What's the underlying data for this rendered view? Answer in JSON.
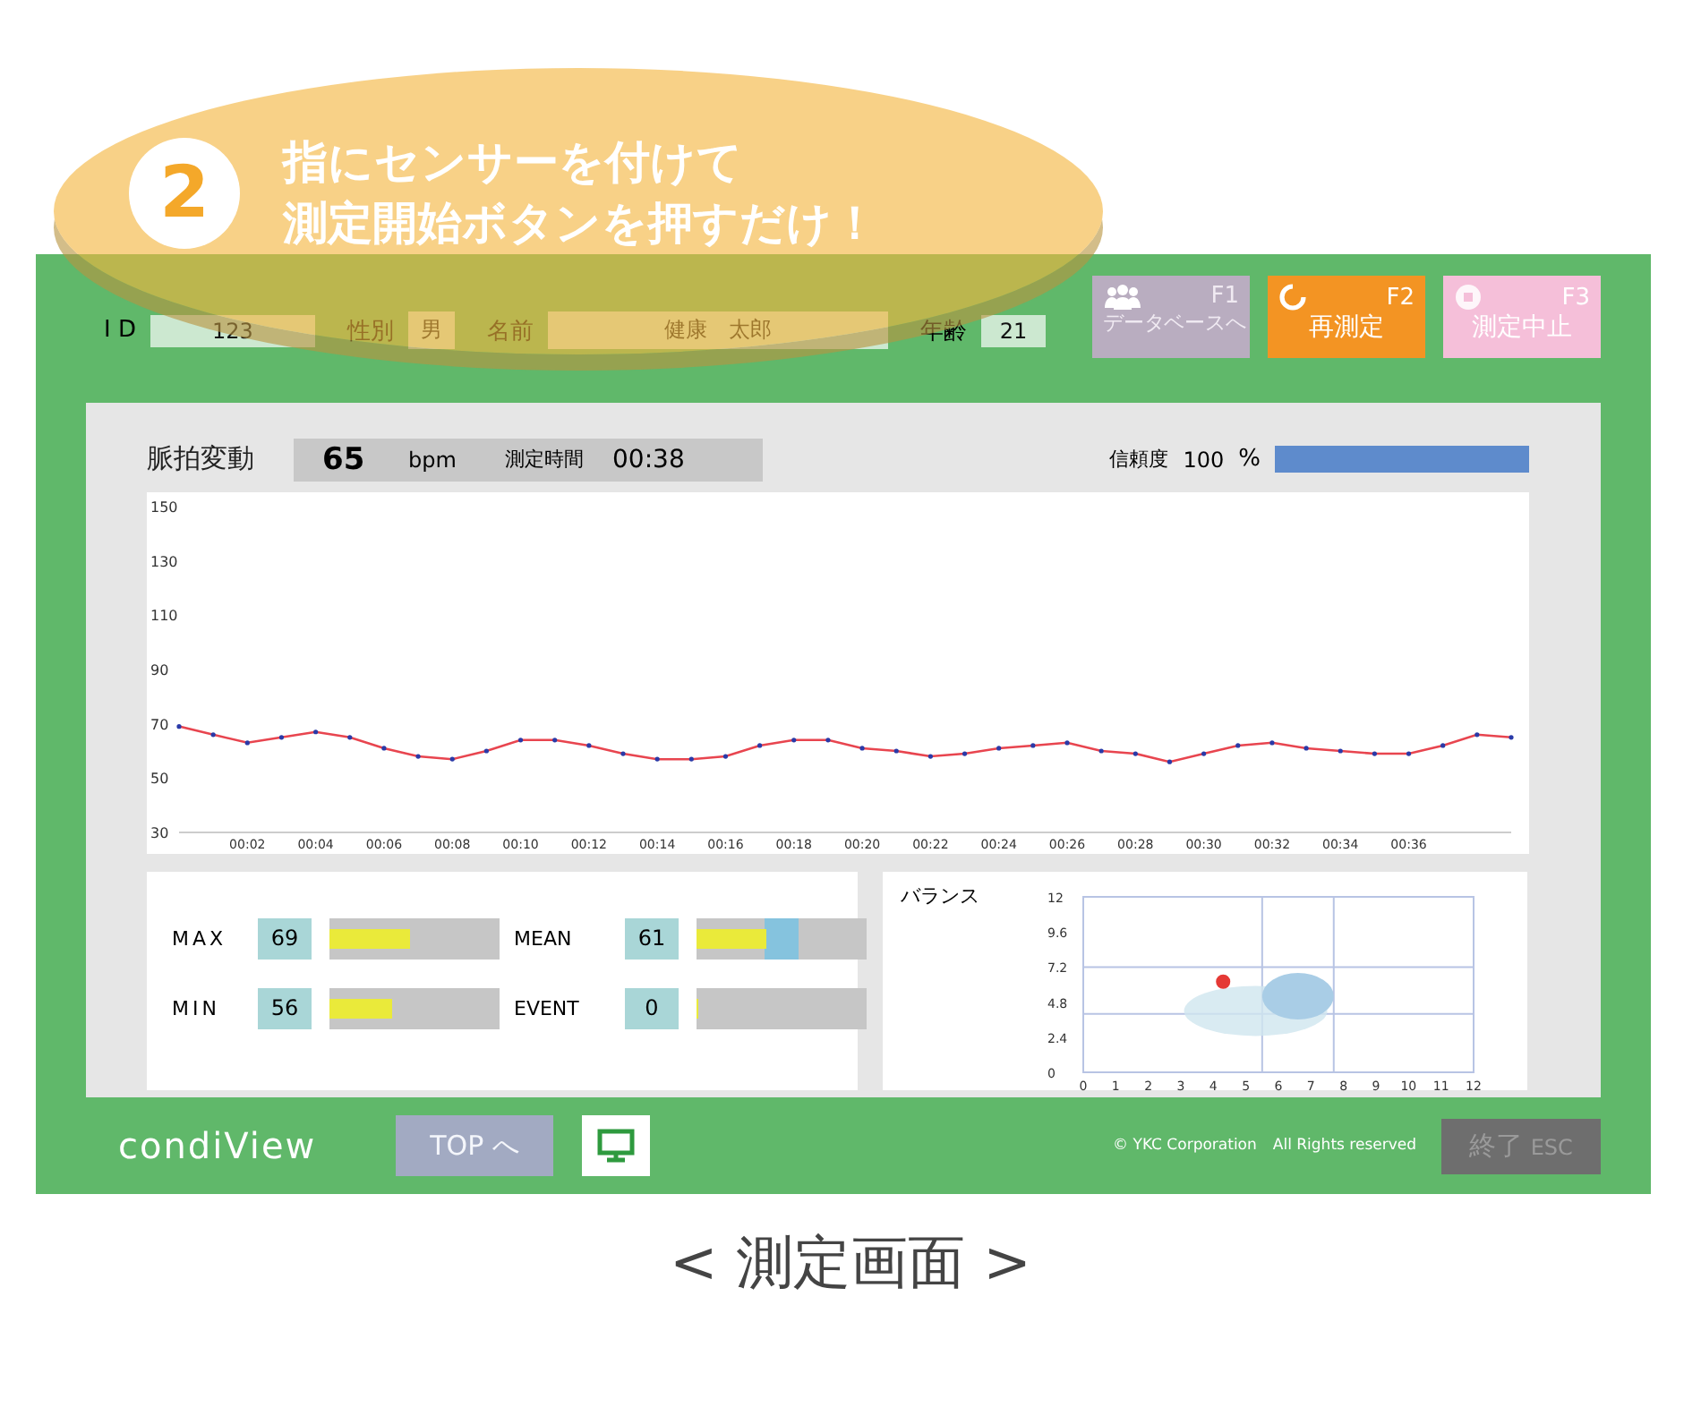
{
  "callout": {
    "number": "2",
    "lines": [
      "指にセンサーを付けて",
      "測定開始ボタンを押すだけ！"
    ]
  },
  "patient": {
    "id_label": "I D",
    "id": "123",
    "sex_label": "性別",
    "sex": "男",
    "name_label": "名前",
    "name": "健康　太郎",
    "age_label": "年齢",
    "age": "21"
  },
  "function_buttons": [
    {
      "key": "F1",
      "label": "データベースへ",
      "color": "#b9adc0",
      "disabled": true
    },
    {
      "key": "F2",
      "label": "再測定",
      "color": "#f39423",
      "disabled": false
    },
    {
      "key": "F3",
      "label": "測定中止",
      "color": "#f5bfd9",
      "disabled": false
    }
  ],
  "pulse": {
    "title": "脈拍変動",
    "bpm": "65",
    "unit": "bpm",
    "time_label": "測定時間",
    "time": "00:38",
    "reliability_label": "信頼度",
    "reliability": "100",
    "reliability_unit": "%",
    "level": 1,
    "chart_data": {
      "type": "line",
      "x": [
        0,
        1,
        2,
        3,
        4,
        5,
        6,
        7,
        8,
        9,
        10,
        11,
        12,
        13,
        14,
        15,
        16,
        17,
        18,
        19,
        20,
        21,
        22,
        23,
        24,
        25,
        26,
        27,
        28,
        29,
        30,
        31,
        32,
        33,
        34,
        35,
        36,
        37,
        38,
        39
      ],
      "series": [
        {
          "color": "#e8454f",
          "values": [
            69,
            66,
            63,
            65,
            67,
            65,
            61,
            58,
            57,
            60,
            64,
            64,
            62,
            59,
            57,
            57,
            58,
            62,
            64,
            64,
            61,
            60,
            58,
            59,
            61,
            62,
            63,
            60,
            59,
            56,
            59,
            62,
            63,
            61,
            60,
            59,
            59,
            62,
            66,
            65
          ]
        }
      ],
      "xlim": [
        0,
        39
      ],
      "ylim": [
        30,
        150
      ],
      "yticks": [
        30,
        50,
        70,
        90,
        110,
        130,
        150
      ],
      "xticks": [
        {
          "value": 2,
          "label": "00:02"
        },
        {
          "value": 4,
          "label": "00:04"
        },
        {
          "value": 6,
          "label": "00:06"
        },
        {
          "value": 8,
          "label": "00:08"
        },
        {
          "value": 10,
          "label": "00:10"
        },
        {
          "value": 12,
          "label": "00:12"
        },
        {
          "value": 14,
          "label": "00:14"
        },
        {
          "value": 16,
          "label": "00:16"
        },
        {
          "value": 18,
          "label": "00:18"
        },
        {
          "value": 20,
          "label": "00:20"
        },
        {
          "value": 22,
          "label": "00:22"
        },
        {
          "value": 24,
          "label": "00:24"
        },
        {
          "value": 26,
          "label": "00:26"
        },
        {
          "value": 28,
          "label": "00:28"
        },
        {
          "value": 30,
          "label": "00:30"
        },
        {
          "value": 32,
          "label": "00:32"
        },
        {
          "value": 34,
          "label": "00:34"
        },
        {
          "value": 36,
          "label": "00:36"
        }
      ]
    }
  },
  "stats": [
    {
      "label": "MAX",
      "value": "69",
      "level": 0.46
    },
    {
      "label": "MEAN",
      "value": "61",
      "level": 0.4
    },
    {
      "label": "MIN",
      "value": "56",
      "level": 0.36
    },
    {
      "label": "EVENT",
      "value": "0",
      "level": 0
    }
  ],
  "balance": {
    "title": "バランス",
    "chart_data": {
      "type": "scatter",
      "x": [
        4.3
      ],
      "series": [
        {
          "color": "#e53935",
          "values": [
            6.2
          ]
        }
      ],
      "xlim": [
        0,
        12
      ],
      "ylim": [
        0,
        12
      ],
      "xticks": [
        0,
        1,
        2,
        3,
        4,
        5,
        6,
        7,
        8,
        9,
        10,
        11,
        12
      ],
      "yticks": [
        0,
        2.4,
        4.8,
        7.2,
        9.6,
        12
      ],
      "ref_lines": [
        {
          "axis": "x",
          "value": 5.5
        },
        {
          "axis": "x",
          "value": 7.7
        },
        {
          "axis": "y",
          "value": 7.2
        },
        {
          "axis": "y",
          "value": 4
        }
      ]
    }
  },
  "footer": {
    "brand": "condiView",
    "top_button": "TOP へ",
    "top_disabled": true,
    "copyright": "© YKC Corporation　All Rights reserved",
    "exit_main": "終了",
    "exit_key": "ESC"
  },
  "caption": "< 測定画面 >"
}
